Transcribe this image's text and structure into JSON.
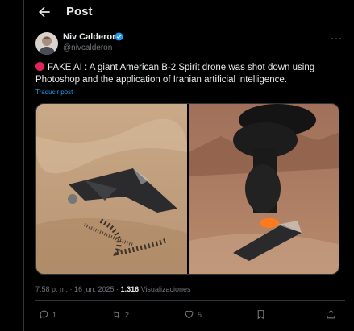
{
  "header": {
    "title": "Post",
    "back_icon": "arrow-left-icon"
  },
  "author": {
    "name": "Niv Calderon",
    "handle": "@nivcalderon",
    "verified_icon": "verified-badge-icon",
    "verified_color": "#1d9bf0"
  },
  "more_label": "···",
  "tweet": {
    "text": "FAKE AI : A giant American B-2 Spirit drone was shot down using Photoshop and the application of Iranian artificial intelligence.",
    "emoji_icon": "red-circle-icon",
    "translate_label": "Traducir post"
  },
  "meta": {
    "time": "7:58 p. m. · 16 jun. 2025 · ",
    "views_count": "1.316",
    "views_label": " Visualizaciones"
  },
  "actions": {
    "reply_count": "1",
    "repost_count": "2",
    "like_count": "5"
  },
  "colors": {
    "background": "#000000",
    "text": "#e7e9ea",
    "muted": "#71767b",
    "accent": "#1d9bf0",
    "border": "#2f3336"
  }
}
